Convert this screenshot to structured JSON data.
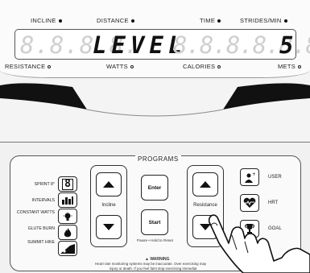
{
  "indicators": {
    "incline": "INCLINE",
    "distance": "DISTANCE",
    "time": "TIME",
    "strides_min": "STRIDES/MIN",
    "resistance": "RESISTANCE",
    "watts": "WATTS",
    "calories": "CALORIES",
    "mets": "METS"
  },
  "display": {
    "ghost_left": "8.8.8.8.",
    "message": "LEVEL",
    "ghost_right": "8.8.8.8.8.8.",
    "value": "5"
  },
  "programs": {
    "title": "PROGRAMS",
    "items": [
      {
        "label": "SPRINT 8°",
        "icon": "sprint8-icon"
      },
      {
        "label": "INTERVALS",
        "icon": "intervals-icon"
      },
      {
        "label": "CONSTANT WATTS",
        "icon": "lightbulb-icon"
      },
      {
        "label": "GLUTE BURN",
        "icon": "flame-icon"
      },
      {
        "label": "SUMMIT HIKE",
        "icon": "mountain-icon"
      }
    ]
  },
  "controls": {
    "incline_label": "Incline",
    "resistance_label": "Resistance",
    "enter_label": "Enter",
    "start_label": "Start",
    "pause_hint": "Pause • Hold to Reset"
  },
  "user_buttons": [
    {
      "label": "USER",
      "icon": "user-icon"
    },
    {
      "label": "HRT",
      "icon": "heart-icon"
    },
    {
      "label": "GOAL",
      "icon": "trophy-icon"
    }
  ],
  "warning": {
    "title": "▲ WARNING",
    "line1": "Heart rate monitoring systems may be inaccurate. Over exercising may",
    "line2": "injury or death. If you feel faint stop exercising immediat"
  },
  "colors": {
    "accent": "#111111",
    "console": "#f4f4f4",
    "ghost": "#cfcfcf"
  }
}
